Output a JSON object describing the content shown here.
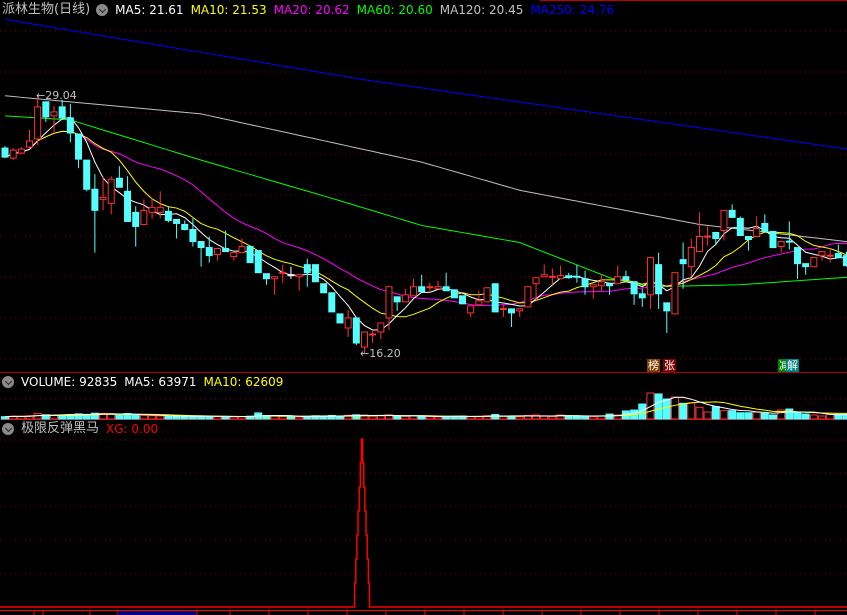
{
  "header": {
    "title": "派林生物(日线)",
    "ma5": "MA5: 21.61",
    "ma10": "MA10: 21.53",
    "ma20": "MA20: 20.62",
    "ma60": "MA60: 20.60",
    "ma120": "MA120: 20.45",
    "ma250": "MA250: 24.76"
  },
  "volume_header": {
    "volume": "VOLUME: 92835",
    "ma5": "MA5: 63971",
    "ma10": "MA10: 62609"
  },
  "xg_header": {
    "name": "极限反弹黑马",
    "xg": "XG: 0.00"
  },
  "annotations": {
    "high": "29.04",
    "low": "16.20",
    "tag1": "榜",
    "tag2": "张",
    "tag3": "减",
    "tag4": "解"
  },
  "colors": {
    "up": "#ff3232",
    "down": "#54ffff",
    "ma5": "#ffffff",
    "ma10": "#ffff00",
    "ma20": "#ff00ff",
    "ma60": "#00ff00",
    "ma120": "#c0c0c0",
    "ma250": "#0000ff",
    "grid": "#800000",
    "axis": "#ff0000"
  },
  "chart_data": {
    "type": "candlestick",
    "title": "派林生物(日线)",
    "price_range": [
      16.2,
      29.04
    ],
    "candles_ohlc": [
      [
        26.4,
        26.5,
        25.9,
        25.95
      ],
      [
        25.9,
        26.4,
        25.8,
        26.3
      ],
      [
        26.15,
        26.45,
        26.1,
        26.35
      ],
      [
        26.45,
        27.3,
        26.4,
        26.75
      ],
      [
        26.85,
        29.04,
        26.55,
        28.45
      ],
      [
        28.7,
        28.7,
        27.7,
        27.95
      ],
      [
        28.0,
        28.5,
        27.2,
        28.2
      ],
      [
        28.45,
        28.8,
        27.9,
        27.9
      ],
      [
        27.9,
        28.6,
        26.7,
        27.15
      ],
      [
        27.1,
        27.1,
        25.4,
        25.85
      ],
      [
        25.8,
        25.8,
        24.25,
        24.35
      ],
      [
        24.35,
        25.1,
        21.2,
        23.3
      ],
      [
        23.85,
        25.0,
        23.3,
        23.95
      ],
      [
        23.65,
        25.0,
        23.1,
        24.85
      ],
      [
        24.9,
        25.5,
        24.45,
        24.45
      ],
      [
        24.25,
        25.0,
        22.75,
        22.75
      ],
      [
        23.2,
        23.5,
        21.5,
        22.5
      ],
      [
        22.6,
        23.85,
        22.6,
        23.3
      ],
      [
        23.2,
        23.9,
        22.9,
        23.45
      ],
      [
        23.2,
        24.25,
        22.9,
        23.45
      ],
      [
        23.25,
        23.5,
        22.7,
        22.8
      ],
      [
        22.85,
        22.85,
        21.9,
        22.65
      ],
      [
        22.6,
        22.8,
        22.3,
        22.35
      ],
      [
        22.35,
        22.9,
        21.5,
        21.75
      ],
      [
        21.75,
        21.75,
        20.5,
        21.45
      ],
      [
        21.45,
        22.0,
        20.7,
        21.05
      ],
      [
        21.1,
        21.4,
        20.8,
        21.4
      ],
      [
        21.4,
        22.3,
        21.25,
        21.25
      ],
      [
        21.0,
        21.2,
        20.8,
        21.2
      ],
      [
        21.2,
        21.9,
        21.2,
        21.5
      ],
      [
        21.5,
        21.5,
        20.7,
        20.7
      ],
      [
        21.3,
        21.3,
        20.2,
        20.2
      ],
      [
        20.15,
        20.15,
        19.6,
        19.9
      ],
      [
        19.9,
        20.0,
        19.1,
        20.0
      ],
      [
        20.2,
        20.6,
        19.7,
        20.22
      ],
      [
        20.1,
        20.5,
        19.9,
        20.1
      ],
      [
        20.0,
        20.1,
        19.3,
        20.1
      ],
      [
        20.6,
        20.9,
        19.5,
        20.2
      ],
      [
        20.6,
        20.6,
        19.75,
        19.75
      ],
      [
        19.65,
        19.65,
        19.2,
        19.2
      ],
      [
        19.2,
        19.2,
        18.25,
        18.25
      ],
      [
        18.15,
        18.15,
        17.7,
        17.7
      ],
      [
        17.45,
        18.35,
        17.0,
        17.95
      ],
      [
        17.95,
        17.95,
        16.6,
        16.7
      ],
      [
        16.5,
        17.25,
        16.2,
        17.25
      ],
      [
        17.1,
        17.3,
        16.7,
        17.15
      ],
      [
        17.25,
        17.7,
        16.9,
        17.7
      ],
      [
        17.95,
        19.5,
        17.35,
        19.5
      ],
      [
        19.0,
        19.0,
        18.3,
        18.75
      ],
      [
        18.75,
        19.4,
        18.75,
        19.1
      ],
      [
        19.05,
        19.9,
        19.05,
        19.5
      ],
      [
        19.5,
        20.1,
        19.25,
        19.25
      ],
      [
        19.45,
        19.7,
        19.2,
        19.5
      ],
      [
        19.4,
        19.8,
        19.4,
        19.5
      ],
      [
        19.5,
        20.2,
        19.3,
        19.3
      ],
      [
        19.35,
        19.35,
        18.95,
        18.95
      ],
      [
        19.05,
        19.05,
        18.65,
        18.65
      ],
      [
        18.2,
        18.55,
        18.0,
        18.55
      ],
      [
        18.6,
        19.3,
        18.6,
        18.8
      ],
      [
        18.75,
        19.45,
        18.75,
        19.45
      ],
      [
        19.65,
        19.65,
        18.25,
        18.25
      ],
      [
        18.38,
        18.6,
        18.0,
        18.42
      ],
      [
        18.4,
        18.4,
        17.5,
        18.2
      ],
      [
        18.3,
        18.4,
        18.0,
        18.4
      ],
      [
        18.5,
        19.5,
        18.5,
        19.5
      ],
      [
        19.65,
        19.95,
        18.8,
        19.95
      ],
      [
        20.0,
        20.6,
        20.0,
        20.1
      ],
      [
        19.98,
        20.4,
        19.6,
        20.02
      ],
      [
        19.9,
        20.55,
        19.9,
        20.05
      ],
      [
        20.05,
        20.2,
        19.9,
        19.95
      ],
      [
        20.02,
        20.6,
        19.7,
        19.98
      ],
      [
        19.9,
        20.3,
        19.1,
        19.5
      ],
      [
        19.5,
        19.6,
        18.9,
        19.6
      ],
      [
        19.55,
        20.1,
        19.3,
        19.75
      ],
      [
        19.65,
        19.65,
        19.1,
        19.55
      ],
      [
        19.65,
        20.55,
        19.65,
        20.0
      ],
      [
        20.0,
        20.3,
        19.85,
        19.85
      ],
      [
        19.75,
        19.75,
        18.6,
        19.15
      ],
      [
        19.15,
        19.4,
        18.5,
        18.95
      ],
      [
        19.1,
        21.0,
        18.4,
        20.95
      ],
      [
        20.6,
        21.2,
        18.4,
        19.15
      ],
      [
        18.7,
        18.7,
        17.2,
        18.3
      ],
      [
        18.15,
        20.2,
        18.15,
        20.2
      ],
      [
        20.85,
        21.7,
        19.4,
        20.65
      ],
      [
        20.5,
        21.9,
        20.0,
        21.45
      ],
      [
        21.25,
        23.2,
        21.25,
        22.0
      ],
      [
        21.98,
        22.5,
        21.55,
        22.02
      ],
      [
        22.2,
        22.2,
        21.6,
        21.9
      ],
      [
        22.3,
        23.3,
        21.8,
        23.3
      ],
      [
        23.3,
        23.6,
        22.95,
        22.95
      ],
      [
        22.9,
        23.0,
        22.05,
        22.05
      ],
      [
        22.0,
        22.0,
        21.3,
        21.85
      ],
      [
        22.0,
        23.0,
        22.0,
        22.4
      ],
      [
        22.65,
        23.1,
        22.25,
        22.25
      ],
      [
        22.25,
        22.25,
        21.45,
        21.45
      ],
      [
        21.5,
        21.75,
        21.2,
        21.75
      ],
      [
        21.77,
        22.75,
        21.35,
        21.73
      ],
      [
        21.45,
        21.45,
        19.9,
        20.65
      ],
      [
        20.65,
        20.65,
        20.1,
        20.5
      ],
      [
        20.5,
        20.95,
        20.5,
        20.95
      ],
      [
        21.05,
        21.25,
        20.8,
        21.25
      ],
      [
        21.03,
        21.4,
        20.7,
        21.07
      ],
      [
        21.15,
        21.6,
        20.95,
        20.95
      ],
      [
        21.05,
        21.25,
        20.5,
        20.55
      ],
      [
        20.55,
        20.6,
        20.3,
        20.4
      ]
    ],
    "ma_long": {
      "ma60": [
        [
          0,
          28.0
        ],
        [
          8,
          27.8
        ],
        [
          24,
          25.8
        ],
        [
          40,
          23.9
        ],
        [
          51,
          22.55
        ],
        [
          63,
          21.7
        ],
        [
          74,
          19.95
        ],
        [
          79,
          19.5
        ],
        [
          90,
          19.6
        ],
        [
          104,
          20.0
        ]
      ],
      "ma120": [
        [
          0,
          29.0
        ],
        [
          24,
          28.1
        ],
        [
          51,
          25.7
        ],
        [
          63,
          24.3
        ],
        [
          85,
          22.6
        ],
        [
          104,
          21.7
        ]
      ],
      "ma250": [
        [
          0,
          32.8
        ],
        [
          44,
          29.8
        ],
        [
          104,
          26.3
        ]
      ]
    },
    "volume": [
      25000,
      30000,
      28000,
      35000,
      60000,
      45000,
      40000,
      38000,
      48000,
      55000,
      50000,
      62000,
      60000,
      55000,
      40000,
      58000,
      42000,
      38000,
      35000,
      32000,
      30000,
      28000,
      26000,
      30000,
      32000,
      28000,
      25000,
      24000,
      22000,
      26000,
      30000,
      65000,
      35000,
      30000,
      28000,
      25000,
      22000,
      28000,
      35000,
      32000,
      38000,
      30000,
      40000,
      45000,
      42000,
      30000,
      35000,
      45000,
      30000,
      28000,
      32000,
      30000,
      25000,
      22000,
      28000,
      30000,
      32000,
      25000,
      24000,
      35000,
      48000,
      28000,
      30000,
      25000,
      38000,
      42000,
      30000,
      25000,
      43000,
      35000,
      35000,
      25000,
      25000,
      32000,
      53000,
      43000,
      86000,
      96000,
      160000,
      278000,
      268000,
      214000,
      235000,
      168000,
      174000,
      125000,
      75000,
      132000,
      89000,
      89000,
      67000,
      67000,
      72000,
      61000,
      43000,
      96000,
      107000,
      72000,
      53000,
      43000,
      32000,
      50000,
      50000,
      50000,
      43000
    ],
    "xg_signal": {
      "index": 44,
      "value": 1
    }
  }
}
